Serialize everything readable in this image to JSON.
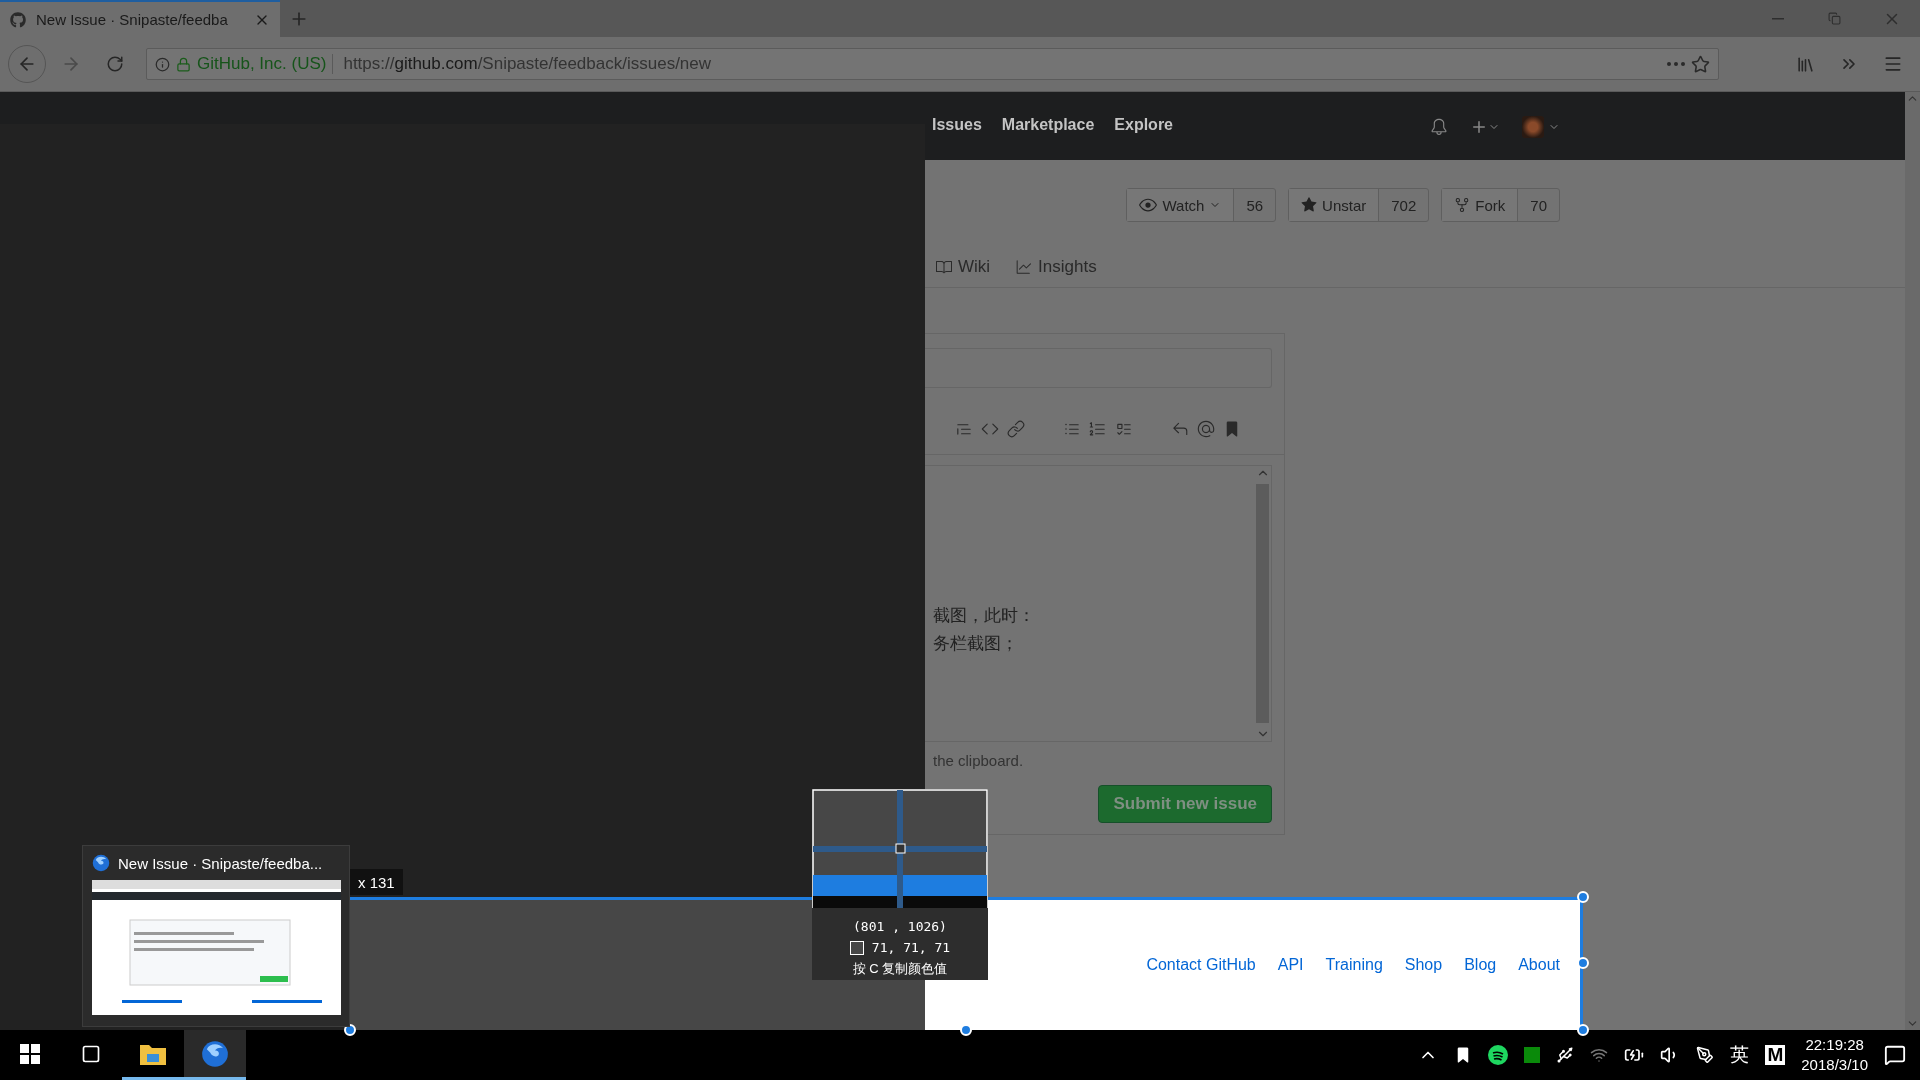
{
  "browser": {
    "tabs": [
      {
        "title": "New Issue · Snipaste/feedba",
        "selected": true
      }
    ],
    "identity": "GitHub, Inc. (US)",
    "url": {
      "scheme": "https://",
      "host": "github.com",
      "path": "/Snipaste/feedback/issues/new"
    }
  },
  "site_header": {
    "nav": [
      "Issues",
      "Marketplace",
      "Explore"
    ]
  },
  "repo_actions": [
    {
      "label": "Watch",
      "count": "56",
      "kind": "watch"
    },
    {
      "label": "Unstar",
      "count": "702",
      "kind": "star"
    },
    {
      "label": "Fork",
      "count": "70",
      "kind": "fork"
    }
  ],
  "repo_tabs": [
    {
      "label": "Wiki",
      "kind": "wiki"
    },
    {
      "label": "Insights",
      "kind": "insights"
    }
  ],
  "editor": {
    "lines": [
      "截图，此时：",
      "务栏截图；"
    ],
    "hint": "the clipboard.",
    "submit": "Submit new issue"
  },
  "footer_links": [
    "Contact GitHub",
    "API",
    "Training",
    "Shop",
    "Blog",
    "About"
  ],
  "snip": {
    "size_label": "x 131",
    "magnifier": {
      "position": "(801 , 1026)",
      "rgb": "71,  71,  71",
      "hint": "按 C 复制颜色值"
    }
  },
  "taskbar": {
    "preview": {
      "title": "New Issue · Snipaste/feedba..."
    },
    "apps": [
      {
        "kind": "explorer",
        "selected": false
      },
      {
        "kind": "firefox",
        "selected": true
      }
    ],
    "ime": "英",
    "tray_letter": "M",
    "time": "22:19:28",
    "date": "2018/3/10"
  }
}
